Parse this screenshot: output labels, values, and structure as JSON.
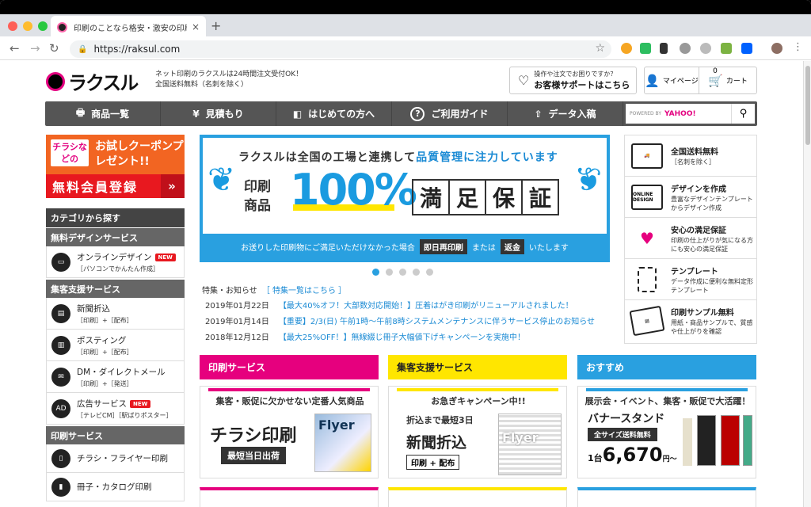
{
  "browser": {
    "tab_title": "印刷のことなら格安・激安の印刷通販",
    "tab_close": "×",
    "new_tab": "+",
    "url": "https://raksul.com"
  },
  "header": {
    "logo_text": "ラクスル",
    "tagline_1": "ネット印刷のラクスルは24時間注文受付OK！",
    "tagline_2": "全国送料無料（名刺を除く）",
    "support_small": "操作や注文でお困りですか？",
    "support_main": "お客様サポートはこちら",
    "mypage": "マイページ",
    "cart": "カート",
    "cart_count": "0"
  },
  "nav": {
    "items": [
      {
        "label": "商品一覧",
        "icon": "printer-icon",
        "glyph": "🖶"
      },
      {
        "label": "見積もり",
        "icon": "yen-icon",
        "glyph": "¥"
      },
      {
        "label": "はじめての方へ",
        "icon": "beginner-icon",
        "glyph": "◧"
      },
      {
        "label": "ご利用ガイド",
        "icon": "question-icon",
        "glyph": "?"
      },
      {
        "label": "データ入稿",
        "icon": "upload-icon",
        "glyph": "⇧"
      }
    ],
    "search_powered": "POWERED BY",
    "search_brand": "YAHOO!",
    "search_icon": "⚲"
  },
  "coupon": {
    "badge": "チラシなどの",
    "title": "お試しクーポンプレゼント!!",
    "register": "無料会員登録",
    "arrow": "»"
  },
  "sidebar": {
    "heading": "カテゴリから探す",
    "sections": [
      {
        "title": "無料デザインサービス"
      },
      {
        "title": "集客支援サービス"
      },
      {
        "title": "印刷サービス"
      }
    ],
    "items": [
      {
        "name": "オンラインデザイン",
        "sub": "［パソコンでかんたん作成］",
        "new": "NEW"
      },
      {
        "name": "新聞折込",
        "sub": "［印刷］+［配布］"
      },
      {
        "name": "ポスティング",
        "sub": "［印刷］+［配布］"
      },
      {
        "name": "DM・ダイレクトメール",
        "sub": "［印刷］+［発送］"
      },
      {
        "name": "広告サービス",
        "sub": "［テレビCM］［駅ばりポスター］",
        "new": "NEW"
      },
      {
        "name": "チラシ・フライヤー印刷",
        "sub": ""
      },
      {
        "name": "冊子・カタログ印刷",
        "sub": ""
      }
    ]
  },
  "banner": {
    "headline_a": "ラクスルは全国の工場と連携して",
    "headline_b": "品質管理に注力しています",
    "product_label_1": "印刷",
    "product_label_2": "商品",
    "percent": "100%",
    "guarantee": [
      "満",
      "足",
      "保",
      "証"
    ],
    "footer_a": "お送りした印刷物にご満足いただけなかった場合",
    "footer_box1": "即日再印刷",
    "footer_or": "または",
    "footer_box2": "返金",
    "footer_end": "いたします"
  },
  "news": {
    "heading": "特集・お知らせ",
    "link": "［ 特集一覧はこちら ］",
    "items": [
      {
        "date": "2019年01月22日",
        "text": "【最大40%オフ！大部数対応開始！】圧着はがき印刷がリニューアルされました！"
      },
      {
        "date": "2019年01月14日",
        "text": "【重要】2/3(日) 午前1時〜午前8時システムメンテナンスに伴うサービス停止のお知らせ"
      },
      {
        "date": "2018年12月12日",
        "text": "【最大25%OFF！】無線綴じ冊子大幅値下げキャンペーンを実施中！"
      }
    ]
  },
  "right_column": [
    {
      "title": "全国送料無料",
      "desc": "［名刺を除く］",
      "icon": "truck-icon"
    },
    {
      "title": "デザインを作成",
      "desc": "豊富なデザインテンプレートからデザイン作成",
      "icon": "online-design-icon",
      "icon_text": "ONLINE DESIGN"
    },
    {
      "title": "安心の満足保証",
      "desc": "印刷の仕上がりが気になる方にも安心の満足保証",
      "icon": "hands-heart-icon"
    },
    {
      "title": "テンプレート",
      "desc": "データ作成に便利な無料定形テンプレート",
      "icon": "template-icon"
    },
    {
      "title": "印刷サンプル無料",
      "desc": "用紙・商品サンプルで、質感や仕上がりを確認",
      "icon": "samples-icon"
    }
  ],
  "services": [
    {
      "head": "印刷サービス",
      "color": "#e6007e",
      "textcolor": "#ffffff",
      "sub": "集客・販促に欠かせない定番人気商品",
      "main": "チラシ印刷",
      "box": "最短当日出荷",
      "img": "Flyer"
    },
    {
      "head": "集客支援サービス",
      "color": "#ffe600",
      "textcolor": "#222222",
      "sub": "お急ぎキャンペーン中!!",
      "sub2": "折込まで最短3日",
      "main": "新聞折込",
      "box": "印刷 + 配布",
      "img": "Flyer"
    },
    {
      "head": "おすすめ",
      "color": "#29a0e0",
      "textcolor": "#ffffff",
      "sub": "展示会・イベント、集客・販促で大活躍！",
      "main": "バナースタンド",
      "box": "全サイズ送料無料",
      "price_prefix": "1台",
      "price": "6,670",
      "price_suffix": "円〜"
    }
  ],
  "carousel": {
    "count": 5,
    "active": 0
  }
}
